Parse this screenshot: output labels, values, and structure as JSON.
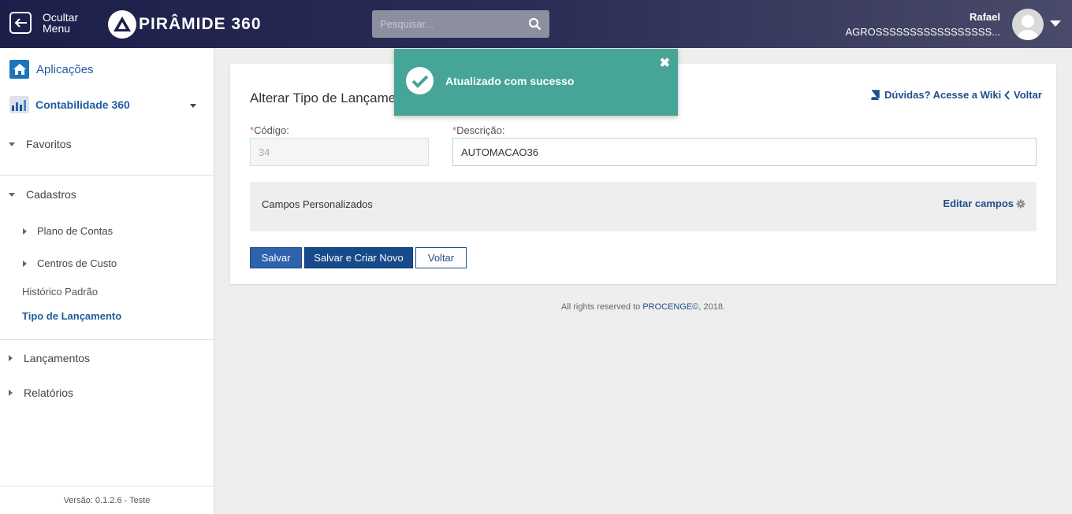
{
  "header": {
    "hide_menu_label": "Ocultar Menu",
    "brand": "PIRÂMIDE 360",
    "search_placeholder": "Pesquisar...",
    "user_name": "Rafael",
    "user_org": "AGROSSSSSSSSSSSSSSSSS..."
  },
  "sidebar": {
    "apps_label": "Aplicações",
    "module_label": "Contabilidade 360",
    "favorites": "Favoritos",
    "cadastros": "Cadastros",
    "plano_contas": "Plano de Contas",
    "centros_custo": "Centros de Custo",
    "historico_padrao": "Histórico Padrão",
    "tipo_lancamento": "Tipo de Lançamento",
    "lancamentos": "Lançamentos",
    "relatorios": "Relatórios",
    "version": "Versão: 0.1.2.6 - Teste"
  },
  "page": {
    "title": "Alterar Tipo de Lançamento",
    "wiki_link": "Dúvidas? Acesse a Wiki",
    "back_link": "Voltar",
    "code_label": "Código:",
    "code_value": "34",
    "desc_label": "Descrição:",
    "desc_value": "AUTOMACAO36",
    "required_mark": "*",
    "custom_fields_label": "Campos Personalizados",
    "edit_fields": "Editar campos",
    "btn_save": "Salvar",
    "btn_save_new": "Salvar e Criar Novo",
    "btn_back": "Voltar"
  },
  "footer": {
    "prefix": "All rights reserved to ",
    "brand": "PROCENGE©",
    "suffix": ", 2018."
  },
  "toast": {
    "message": "Atualizado com sucesso",
    "close": "✖"
  },
  "colors": {
    "toast_bg": "#46a597",
    "primary": "#2e62ad",
    "link": "#1f4e8c"
  }
}
